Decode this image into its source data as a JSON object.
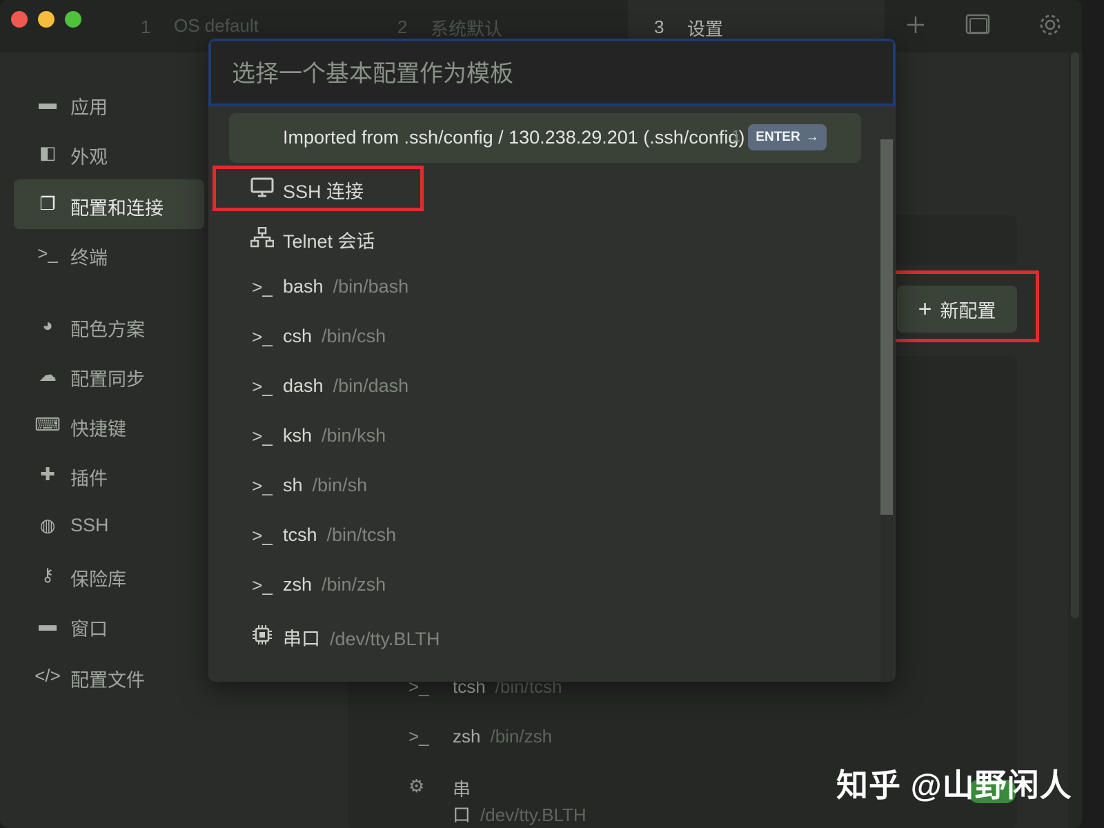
{
  "colors": {
    "accent": "#3b4238",
    "highlight_box": "#e32b2b",
    "focus_border": "#1f3b73"
  },
  "tabs": [
    {
      "num": "1",
      "label": "OS default"
    },
    {
      "num": "2",
      "label": "系统默认"
    },
    {
      "num": "3",
      "label": "设置"
    }
  ],
  "titlebar_icons": [
    "plus-icon",
    "window-icon",
    "gear-icon"
  ],
  "sidebar": {
    "items": [
      {
        "label": "应用",
        "icon": "app-window-icon",
        "glyph": "▬"
      },
      {
        "label": "外观",
        "icon": "appearance-icon",
        "glyph": "◧"
      },
      {
        "label": "配置和连接",
        "icon": "profiles-icon",
        "glyph": "❐"
      },
      {
        "label": "终端",
        "icon": "terminal-icon",
        "glyph": ">_"
      },
      {
        "label": "配色方案",
        "icon": "palette-icon",
        "glyph": "◕"
      },
      {
        "label": "配置同步",
        "icon": "cloud-icon",
        "glyph": "☁"
      },
      {
        "label": "快捷键",
        "icon": "keyboard-icon",
        "glyph": "⌨"
      },
      {
        "label": "插件",
        "icon": "puzzle-icon",
        "glyph": "✚"
      },
      {
        "label": "SSH",
        "icon": "globe-icon",
        "glyph": "◍"
      },
      {
        "label": "保险库",
        "icon": "key-icon",
        "glyph": "⚷"
      },
      {
        "label": "窗口",
        "icon": "window-icon",
        "glyph": "▬"
      },
      {
        "label": "配置文件",
        "icon": "code-icon",
        "glyph": "</>"
      }
    ]
  },
  "background": {
    "input_fragment": "人",
    "new_config_label": "新配置",
    "rows": [
      {
        "name": "tcsh",
        "path": "/bin/tcsh",
        "glyph": ">_"
      },
      {
        "name": "zsh",
        "path": "/bin/zsh",
        "glyph": ">_"
      },
      {
        "name": "串口",
        "path": "/dev/tty.BLTH",
        "glyph": "⚙"
      }
    ]
  },
  "modal": {
    "placeholder": "选择一个基本配置作为模板",
    "imported": {
      "label": "Imported from .ssh/config / 130.238.29.201 (.ssh/config)",
      "hint": "1",
      "enter": "ENTER"
    },
    "options": [
      {
        "name": "SSH 连接",
        "path": "",
        "icon": "monitor-icon",
        "glyph": "🖥"
      },
      {
        "name": "Telnet 会话",
        "path": "",
        "icon": "network-icon",
        "glyph": "品"
      },
      {
        "name": "bash",
        "path": "/bin/bash",
        "icon": "terminal-icon",
        "glyph": ">_"
      },
      {
        "name": "csh",
        "path": "/bin/csh",
        "icon": "terminal-icon",
        "glyph": ">_"
      },
      {
        "name": "dash",
        "path": "/bin/dash",
        "icon": "terminal-icon",
        "glyph": ">_"
      },
      {
        "name": "ksh",
        "path": "/bin/ksh",
        "icon": "terminal-icon",
        "glyph": ">_"
      },
      {
        "name": "sh",
        "path": "/bin/sh",
        "icon": "terminal-icon",
        "glyph": ">_"
      },
      {
        "name": "tcsh",
        "path": "/bin/tcsh",
        "icon": "terminal-icon",
        "glyph": ">_"
      },
      {
        "name": "zsh",
        "path": "/bin/zsh",
        "icon": "terminal-icon",
        "glyph": ">_"
      },
      {
        "name": "串口",
        "path": "/dev/tty.BLTH",
        "icon": "chip-icon",
        "glyph": "⚙"
      }
    ]
  },
  "watermark": "知乎 @山野闲人"
}
